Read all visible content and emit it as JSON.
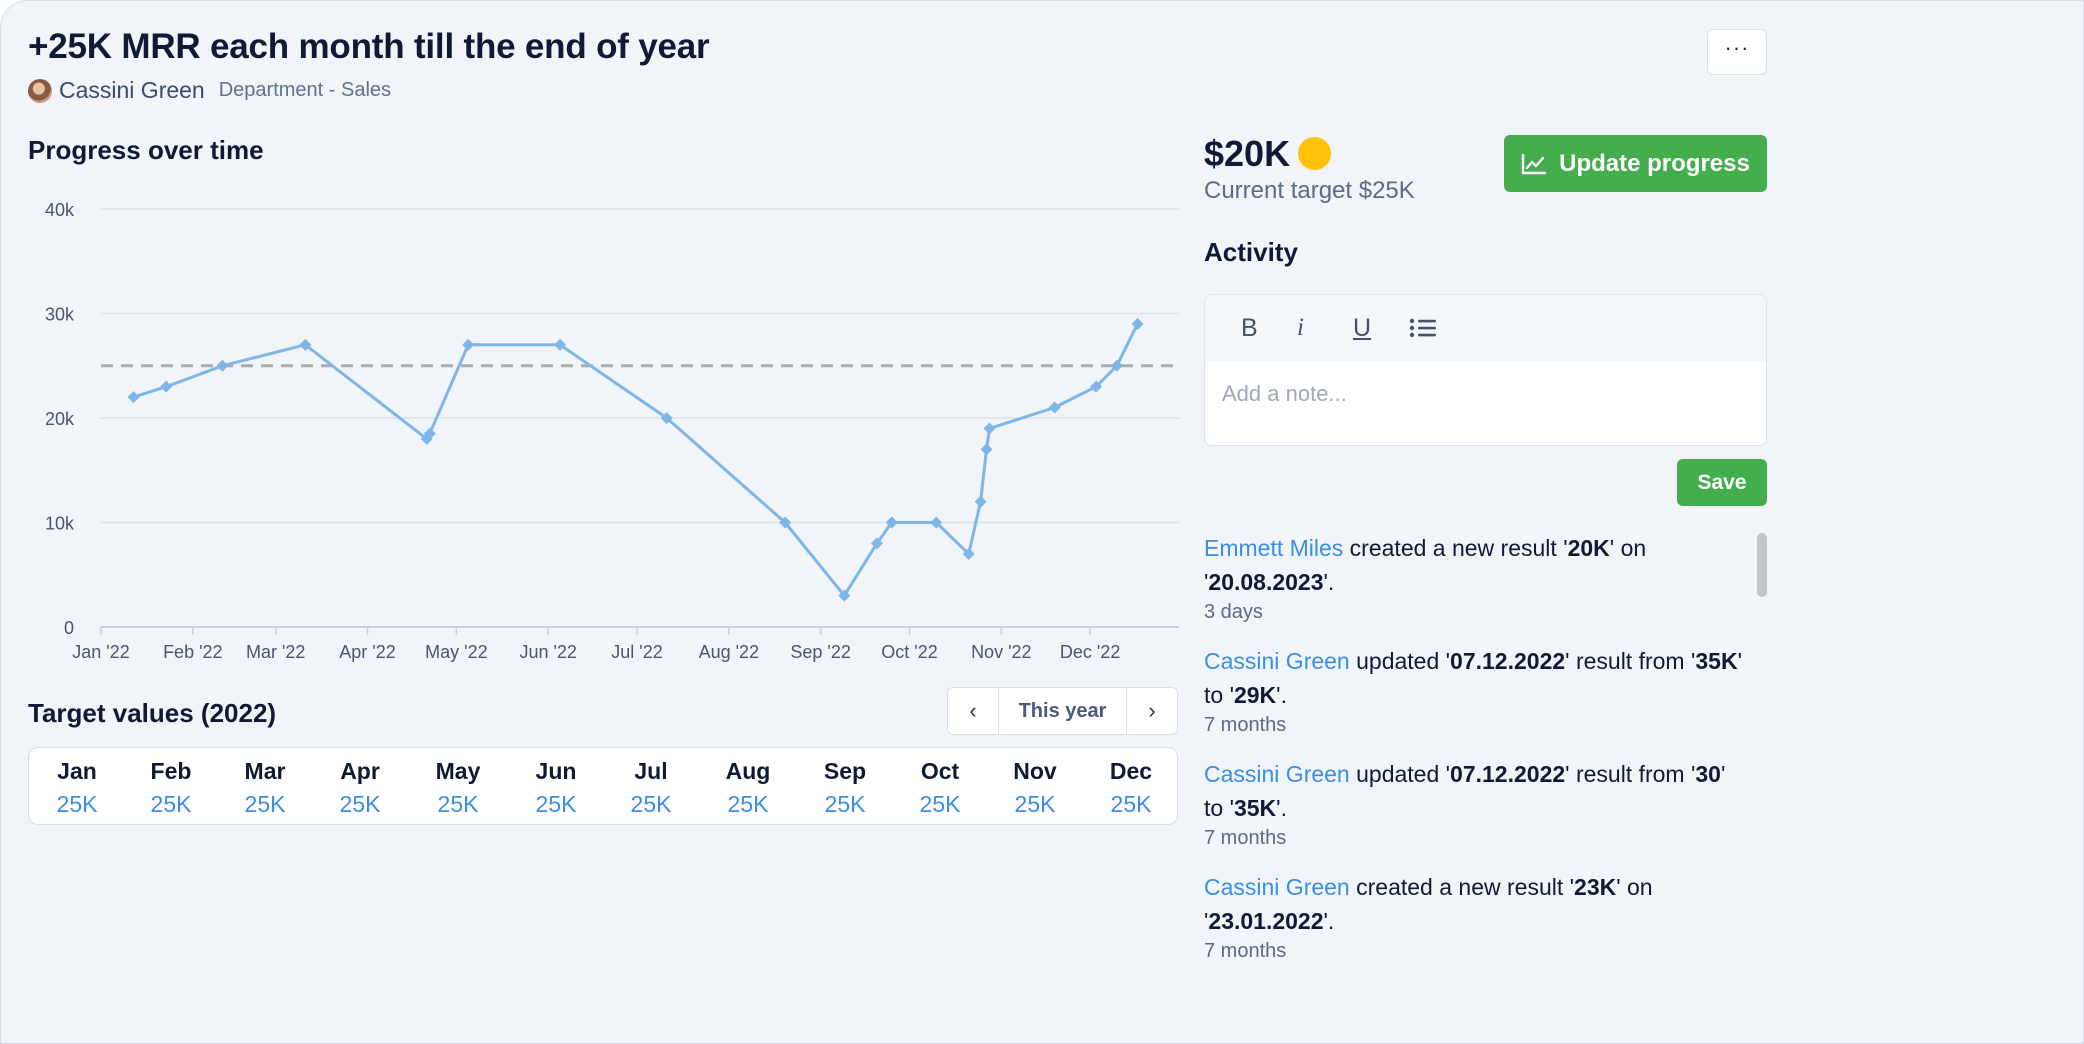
{
  "header": {
    "title": "+25K MRR each month till the end of year",
    "owner": "Cassini Green",
    "department": "Department - Sales",
    "more_label": "···"
  },
  "progress": {
    "section_title": "Progress over time"
  },
  "chart_data": {
    "type": "line",
    "title": "Progress over time",
    "x_tick_labels": [
      "Jan '22",
      "Feb '22",
      "Mar '22",
      "Apr '22",
      "May '22",
      "Jun '22",
      "Jul '22",
      "Aug '22",
      "Sep '22",
      "Oct '22",
      "Nov '22",
      "Dec '22"
    ],
    "y_tick_labels": [
      "0",
      "10k",
      "20k",
      "30k",
      "40k"
    ],
    "y_ticks": [
      0,
      10000,
      20000,
      30000,
      40000
    ],
    "ylim": [
      0,
      40000
    ],
    "xlim": [
      "2022-01-01",
      "2022-12-31"
    ],
    "grid": true,
    "target_line": 25000,
    "series": [
      {
        "color": "#7eb6e9",
        "points": [
          {
            "x": "2022-01-12",
            "y": 22000
          },
          {
            "x": "2022-01-23",
            "y": 23000
          },
          {
            "x": "2022-02-11",
            "y": 25000
          },
          {
            "x": "2022-03-11",
            "y": 27000
          },
          {
            "x": "2022-04-21",
            "y": 18000
          },
          {
            "x": "2022-04-22",
            "y": 18500
          },
          {
            "x": "2022-05-05",
            "y": 27000
          },
          {
            "x": "2022-06-05",
            "y": 27000
          },
          {
            "x": "2022-07-11",
            "y": 20000
          },
          {
            "x": "2022-08-20",
            "y": 10000
          },
          {
            "x": "2022-09-09",
            "y": 3000
          },
          {
            "x": "2022-09-20",
            "y": 8000
          },
          {
            "x": "2022-09-25",
            "y": 10000
          },
          {
            "x": "2022-10-10",
            "y": 10000
          },
          {
            "x": "2022-10-21",
            "y": 7000
          },
          {
            "x": "2022-10-25",
            "y": 12000
          },
          {
            "x": "2022-10-27",
            "y": 17000
          },
          {
            "x": "2022-10-28",
            "y": 19000
          },
          {
            "x": "2022-11-19",
            "y": 21000
          },
          {
            "x": "2022-12-03",
            "y": 23000
          },
          {
            "x": "2022-12-10",
            "y": 25000
          },
          {
            "x": "2022-12-17",
            "y": 29000
          }
        ]
      }
    ]
  },
  "targets": {
    "title": "Target values (2022)",
    "period_label": "This year",
    "prev_icon": "‹",
    "next_icon": "›",
    "months": [
      {
        "month": "Jan",
        "value": "25K"
      },
      {
        "month": "Feb",
        "value": "25K"
      },
      {
        "month": "Mar",
        "value": "25K"
      },
      {
        "month": "Apr",
        "value": "25K"
      },
      {
        "month": "May",
        "value": "25K"
      },
      {
        "month": "Jun",
        "value": "25K"
      },
      {
        "month": "Jul",
        "value": "25K"
      },
      {
        "month": "Aug",
        "value": "25K"
      },
      {
        "month": "Sep",
        "value": "25K"
      },
      {
        "month": "Oct",
        "value": "25K"
      },
      {
        "month": "Nov",
        "value": "25K"
      },
      {
        "month": "Dec",
        "value": "25K"
      }
    ]
  },
  "status": {
    "current_value": "$20K",
    "status_color": "#ffc107",
    "current_target": "Current target $25K",
    "update_label": "Update progress"
  },
  "activity": {
    "title": "Activity",
    "toolbar": {
      "bold": "B",
      "italic": "i",
      "underline": "U"
    },
    "note_placeholder": "Add a note...",
    "save_label": "Save",
    "items": [
      {
        "user": "Emmett Miles",
        "parts": [
          " created a new result '",
          "20K",
          "' on '",
          "20.08.2023",
          "'."
        ],
        "time": "3 days"
      },
      {
        "user": "Cassini Green",
        "parts": [
          " updated '",
          "07.12.2022",
          "' result from '",
          "35K",
          "' to '",
          "29K",
          "'."
        ],
        "time": "7 months"
      },
      {
        "user": "Cassini Green",
        "parts": [
          " updated '",
          "07.12.2022",
          "' result from '",
          "30",
          "' to '",
          "35K",
          "'."
        ],
        "time": "7 months"
      },
      {
        "user": "Cassini Green",
        "parts": [
          " created a new result '",
          "23K",
          "' on '",
          "23.01.2022",
          "'."
        ],
        "time": "7 months"
      }
    ]
  },
  "colors": {
    "accent": "#3a8ee6",
    "success": "#44ae4f",
    "line": "#7eb6e9",
    "target_line": "#a9adb3"
  }
}
